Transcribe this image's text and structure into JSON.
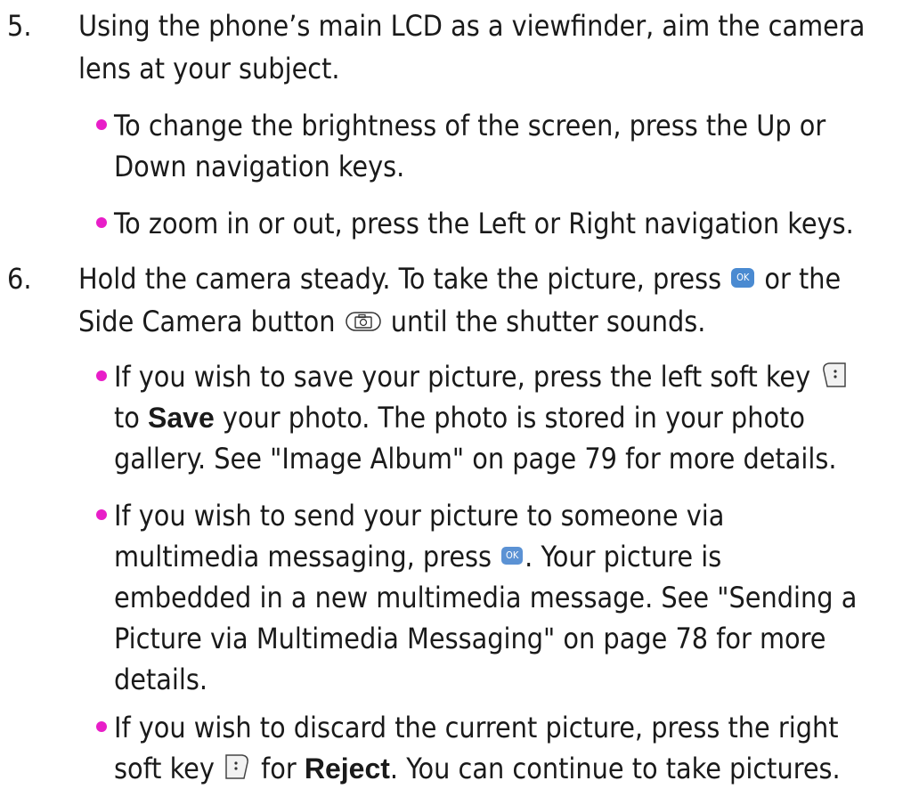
{
  "colors": {
    "bullet": "#e81ec8",
    "ok_key": "#4a8ad1",
    "text": "#1a1a1a"
  },
  "icons": {
    "ok": "ok-key-icon",
    "camera": "side-camera-button-icon",
    "left_soft": "left-soft-key-icon",
    "right_soft": "right-soft-key-icon"
  },
  "step5": {
    "number": "5.",
    "line1": "Using the phone’s main LCD as a viewfinder, aim the camera",
    "line2": "lens at your subject.",
    "bullets": [
      {
        "line1": "To change the brightness of the screen, press the Up or",
        "line2": "Down navigation keys."
      },
      {
        "line1": "To zoom in or out, press the Left or Right navigation keys."
      }
    ]
  },
  "step6": {
    "number": "6.",
    "line1_pre": "Hold the camera steady. To take the picture, press",
    "line1_post": "or the",
    "line2_pre": "Side Camera button",
    "line2_post": "until the shutter sounds.",
    "ok_label": "OK",
    "bullet_save": {
      "line1": "If you wish to save your picture, press the left soft key",
      "line2_pre": "to",
      "term": "Save",
      "line2_post": "your photo. The photo is stored in your photo",
      "line3": "gallery. See \"Image Album\" on page 79 for more details."
    },
    "bullet_send": {
      "line1": "If you wish to send your picture to someone via",
      "line2_pre": "multimedia messaging, press",
      "line2_post": ". Your picture is",
      "line3": "embedded in a new multimedia message. See \"Sending a",
      "line4": "Picture via Multimedia Messaging\" on page 78 for more",
      "line5": "details."
    },
    "bullet_reject": {
      "line1": "If you wish to discard the current picture, press the right",
      "line2_pre": "soft key",
      "line2_mid": "for",
      "term": "Reject",
      "line2_post": ". You can continue to take pictures."
    }
  }
}
